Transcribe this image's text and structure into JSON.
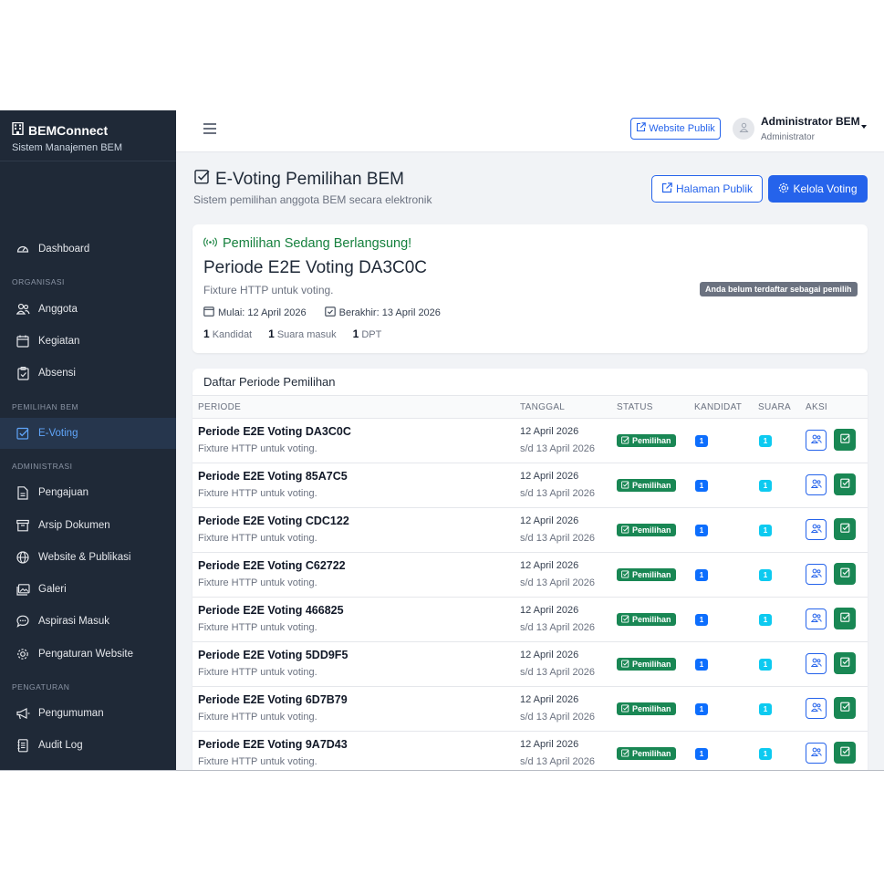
{
  "brand": {
    "title": "BEMConnect",
    "subtitle": "Sistem Manajemen BEM"
  },
  "sidebar": {
    "items": [
      {
        "label": "Dashboard",
        "icon": "gauge-icon"
      },
      {
        "label": "Anggota",
        "icon": "users-icon"
      },
      {
        "label": "Kegiatan",
        "icon": "calendar-icon"
      },
      {
        "label": "Absensi",
        "icon": "clipboard-icon"
      },
      {
        "label": "E-Voting",
        "icon": "check-square-icon",
        "active": true
      },
      {
        "label": "Pengajuan",
        "icon": "file-icon"
      },
      {
        "label": "Arsip Dokumen",
        "icon": "archive-icon"
      },
      {
        "label": "Website & Publikasi",
        "icon": "globe-icon"
      },
      {
        "label": "Galeri",
        "icon": "images-icon"
      },
      {
        "label": "Aspirasi Masuk",
        "icon": "chat-icon"
      },
      {
        "label": "Pengaturan Website",
        "icon": "gear-icon"
      },
      {
        "label": "Pengumuman",
        "icon": "megaphone-icon"
      },
      {
        "label": "Audit Log",
        "icon": "journal-icon"
      }
    ],
    "sections": [
      "ORGANISASI",
      "PEMILIHAN BEM",
      "ADMINISTRASI",
      "PENGATURAN"
    ]
  },
  "topbar": {
    "public_site_label": "Website Publik",
    "user_name": "Administrator BEM",
    "user_role": "Administrator"
  },
  "header": {
    "title": "E-Voting Pemilihan BEM",
    "subtitle": "Sistem pemilihan anggota BEM secara elektronik",
    "public_page_label": "Halaman Publik",
    "manage_label": "Kelola Voting"
  },
  "active": {
    "status": "Pemilihan Sedang Berlangsung!",
    "title": "Periode E2E Voting DA3C0C",
    "description": "Fixture HTTP untuk voting.",
    "start": "Mulai: 12 April 2026",
    "end": "Berakhir: 13 April 2026",
    "candidates_count": "1",
    "candidates_label": "Kandidat",
    "votes_count": "1",
    "votes_label": "Suara masuk",
    "dpt_count": "1",
    "dpt_label": "DPT",
    "voter_notice": "Anda belum terdaftar sebagai pemilih"
  },
  "table": {
    "title": "Daftar Periode Pemilihan",
    "columns": [
      "PERIODE",
      "TANGGAL",
      "STATUS",
      "KANDIDAT",
      "SUARA",
      "AKSI"
    ],
    "rows": [
      {
        "name": "Periode E2E Voting DA3C0C",
        "desc": "Fixture HTTP untuk voting.",
        "date_start": "12 April 2026",
        "date_end": "s/d 13 April 2026",
        "status": "Pemilihan",
        "kandidat": "1",
        "suara": "1"
      },
      {
        "name": "Periode E2E Voting 85A7C5",
        "desc": "Fixture HTTP untuk voting.",
        "date_start": "12 April 2026",
        "date_end": "s/d 13 April 2026",
        "status": "Pemilihan",
        "kandidat": "1",
        "suara": "1"
      },
      {
        "name": "Periode E2E Voting CDC122",
        "desc": "Fixture HTTP untuk voting.",
        "date_start": "12 April 2026",
        "date_end": "s/d 13 April 2026",
        "status": "Pemilihan",
        "kandidat": "1",
        "suara": "1"
      },
      {
        "name": "Periode E2E Voting C62722",
        "desc": "Fixture HTTP untuk voting.",
        "date_start": "12 April 2026",
        "date_end": "s/d 13 April 2026",
        "status": "Pemilihan",
        "kandidat": "1",
        "suara": "1"
      },
      {
        "name": "Periode E2E Voting 466825",
        "desc": "Fixture HTTP untuk voting.",
        "date_start": "12 April 2026",
        "date_end": "s/d 13 April 2026",
        "status": "Pemilihan",
        "kandidat": "1",
        "suara": "1"
      },
      {
        "name": "Periode E2E Voting 5DD9F5",
        "desc": "Fixture HTTP untuk voting.",
        "date_start": "12 April 2026",
        "date_end": "s/d 13 April 2026",
        "status": "Pemilihan",
        "kandidat": "1",
        "suara": "1"
      },
      {
        "name": "Periode E2E Voting 6D7B79",
        "desc": "Fixture HTTP untuk voting.",
        "date_start": "12 April 2026",
        "date_end": "s/d 13 April 2026",
        "status": "Pemilihan",
        "kandidat": "1",
        "suara": "1"
      },
      {
        "name": "Periode E2E Voting 9A7D43",
        "desc": "Fixture HTTP untuk voting.",
        "date_start": "12 April 2026",
        "date_end": "s/d 13 April 2026",
        "status": "Pemilihan",
        "kandidat": "1",
        "suara": "1"
      }
    ]
  },
  "colors": {
    "primary": "#2563eb",
    "success": "#198754",
    "info": "#0dcaf0",
    "sidebar": "#1f2937"
  }
}
